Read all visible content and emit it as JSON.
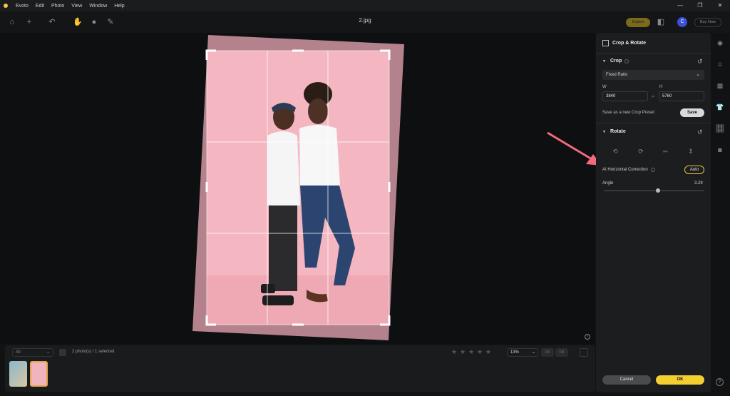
{
  "menubar": {
    "app_name": "Evoto",
    "items": [
      "Edit",
      "Photo",
      "View",
      "Window",
      "Help"
    ],
    "window_controls": [
      "—",
      "❐",
      "✕"
    ]
  },
  "toolbar": {
    "doc_title": "2.jpg",
    "export_label": "Export",
    "avatar_letter": "C",
    "buy_now_label": "Buy Now"
  },
  "bottombar": {
    "filter_value": "All",
    "photo_count": "2 photo(s) / 1 selected",
    "zoom": "13%",
    "fit_label": "Fit",
    "fill_label": "Fill"
  },
  "panel": {
    "title": "Crop & Rotate",
    "crop": {
      "title": "Crop",
      "ratio": "Fixed Ratio",
      "w_label": "W",
      "h_label": "H",
      "w_value": "3840",
      "h_value": "5760",
      "preset_label": "Save as a new Crop Preset",
      "save_label": "Save"
    },
    "rotate": {
      "title": "Rotate",
      "ai_label": "AI Horizontal Correction",
      "auto_label": "Auto",
      "angle_label": "Angle",
      "angle_value": "3.29",
      "angle_fraction": 0.54
    },
    "cancel_label": "Cancel",
    "ok_label": "OK"
  },
  "colors": {
    "accent": "#f3d02f",
    "export_bg": "#7a6a1a",
    "avatar": "#3b4fd8",
    "arrow": "#f06b7e",
    "photo_bg": "#f4b6c0"
  }
}
